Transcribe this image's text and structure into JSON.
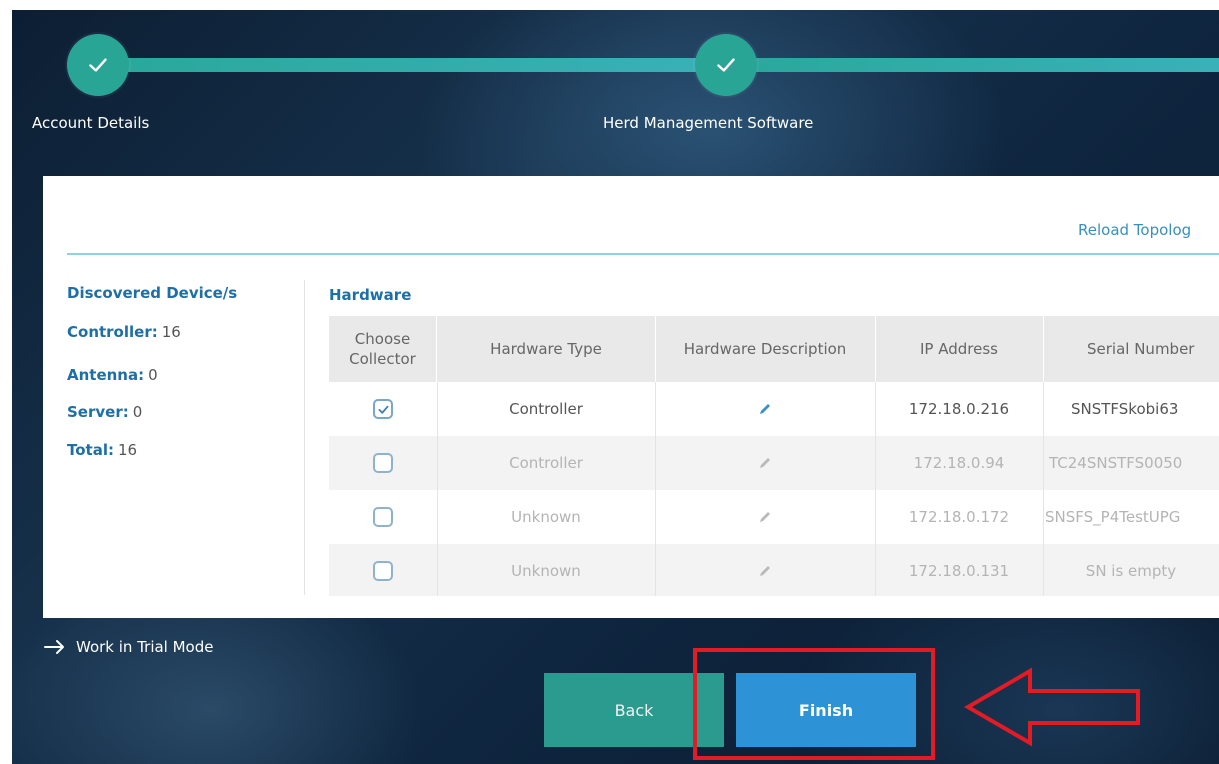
{
  "stepper": {
    "steps": [
      {
        "label": "Account Details",
        "state": "complete"
      },
      {
        "label": "Herd Management Software",
        "state": "complete"
      }
    ]
  },
  "panel": {
    "reload_link": "Reload Topolog",
    "discovered": {
      "title": "Discovered Device/s",
      "items": [
        {
          "label": "Controller:",
          "value": "16"
        },
        {
          "label": "Antenna:",
          "value": "0"
        },
        {
          "label": "Server:",
          "value": "0"
        },
        {
          "label": "Total:",
          "value": "16"
        }
      ]
    },
    "hardware": {
      "title": "Hardware",
      "columns": [
        "Choose Collector",
        "Hardware Type",
        "Hardware Description",
        "IP Address",
        "Serial Number"
      ],
      "rows": [
        {
          "checked": true,
          "type": "Controller",
          "description_icon": "pencil-icon",
          "ip": "172.18.0.216",
          "serial": "SNSTFSkobi63"
        },
        {
          "checked": false,
          "type": "Controller",
          "description_icon": "pencil-icon",
          "ip": "172.18.0.94",
          "serial": "TC24SNSTFS0050"
        },
        {
          "checked": false,
          "type": "Unknown",
          "description_icon": "pencil-icon",
          "ip": "172.18.0.172",
          "serial": "SNSFS_P4TestUPG"
        },
        {
          "checked": false,
          "type": "Unknown",
          "description_icon": "pencil-icon",
          "ip": "172.18.0.131",
          "serial": "SN is empty"
        }
      ]
    }
  },
  "trial": {
    "label": "Work in Trial Mode",
    "icon": "arrow-right-icon"
  },
  "buttons": {
    "back": "Back",
    "finish": "Finish"
  },
  "colors": {
    "accent_teal": "#29a596",
    "finish_blue": "#2e92d6",
    "link_blue": "#1e6fa6",
    "annotation_red": "#e21b24"
  }
}
